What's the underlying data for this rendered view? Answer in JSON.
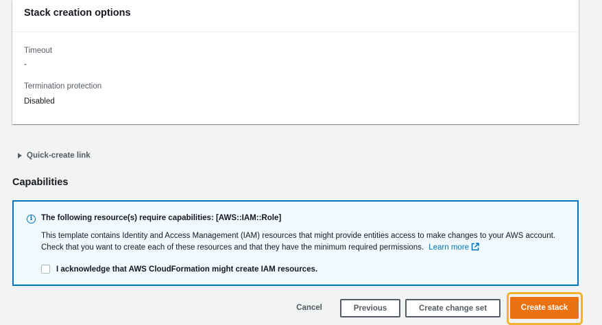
{
  "stack_options": {
    "title": "Stack creation options",
    "timeout_label": "Timeout",
    "timeout_value": "-",
    "termination_label": "Termination protection",
    "termination_value": "Disabled"
  },
  "quick_create": {
    "label": "Quick-create link",
    "expanded": false,
    "icon": "caret-right-icon"
  },
  "capabilities": {
    "heading": "Capabilities",
    "alert": {
      "icon": "info-icon",
      "title": "The following resource(s) require capabilities: [AWS::IAM::Role]",
      "text": "This template contains Identity and Access Management (IAM) resources that might provide entities access to make changes to your AWS account. Check that you want to create each of these resources and that they have the minimum required permissions.",
      "link_label": "Learn more",
      "link_icon": "external-link-icon",
      "accent_color": "#0073bb",
      "background_color": "#f1faff"
    },
    "acknowledge_label": "I acknowledge that AWS CloudFormation might create IAM resources.",
    "acknowledge_checked": false
  },
  "footer": {
    "cancel_label": "Cancel",
    "previous_label": "Previous",
    "change_set_label": "Create change set",
    "create_label": "Create stack",
    "primary_color": "#ec7211",
    "focus_color": "#f2b22e"
  }
}
